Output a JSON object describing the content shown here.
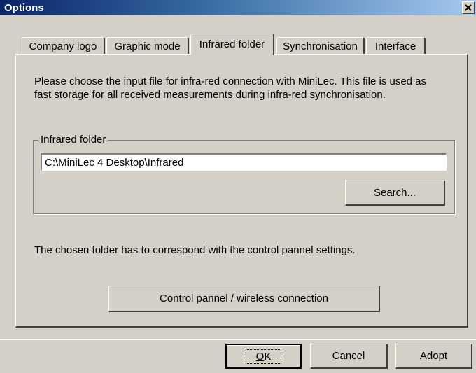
{
  "window": {
    "title": "Options",
    "close_glyph": "×"
  },
  "tabs": [
    {
      "label": "Company logo",
      "active": false
    },
    {
      "label": "Graphic mode",
      "active": false
    },
    {
      "label": "Infrared folder",
      "active": true
    },
    {
      "label": "Synchronisation",
      "active": false
    },
    {
      "label": "Interface",
      "active": false
    }
  ],
  "content": {
    "description_line1": "Please choose the input file for infra-red connection with MiniLec. This file is used as",
    "description_line2": "fast storage for all received measurements during infra-red synchronisation.",
    "group_label": "Infrared folder",
    "folder_path": "C:\\MiniLec 4 Desktop\\Infrared",
    "search_label": "Search...",
    "note": "The chosen folder has to correspond with the control pannel settings.",
    "control_panel_label": "Control pannel / wireless connection"
  },
  "footer": {
    "ok_mnemonic": "O",
    "ok_rest": "K",
    "cancel_mnemonic": "C",
    "cancel_rest": "ancel",
    "adopt_mnemonic": "A",
    "adopt_rest": "dopt"
  }
}
